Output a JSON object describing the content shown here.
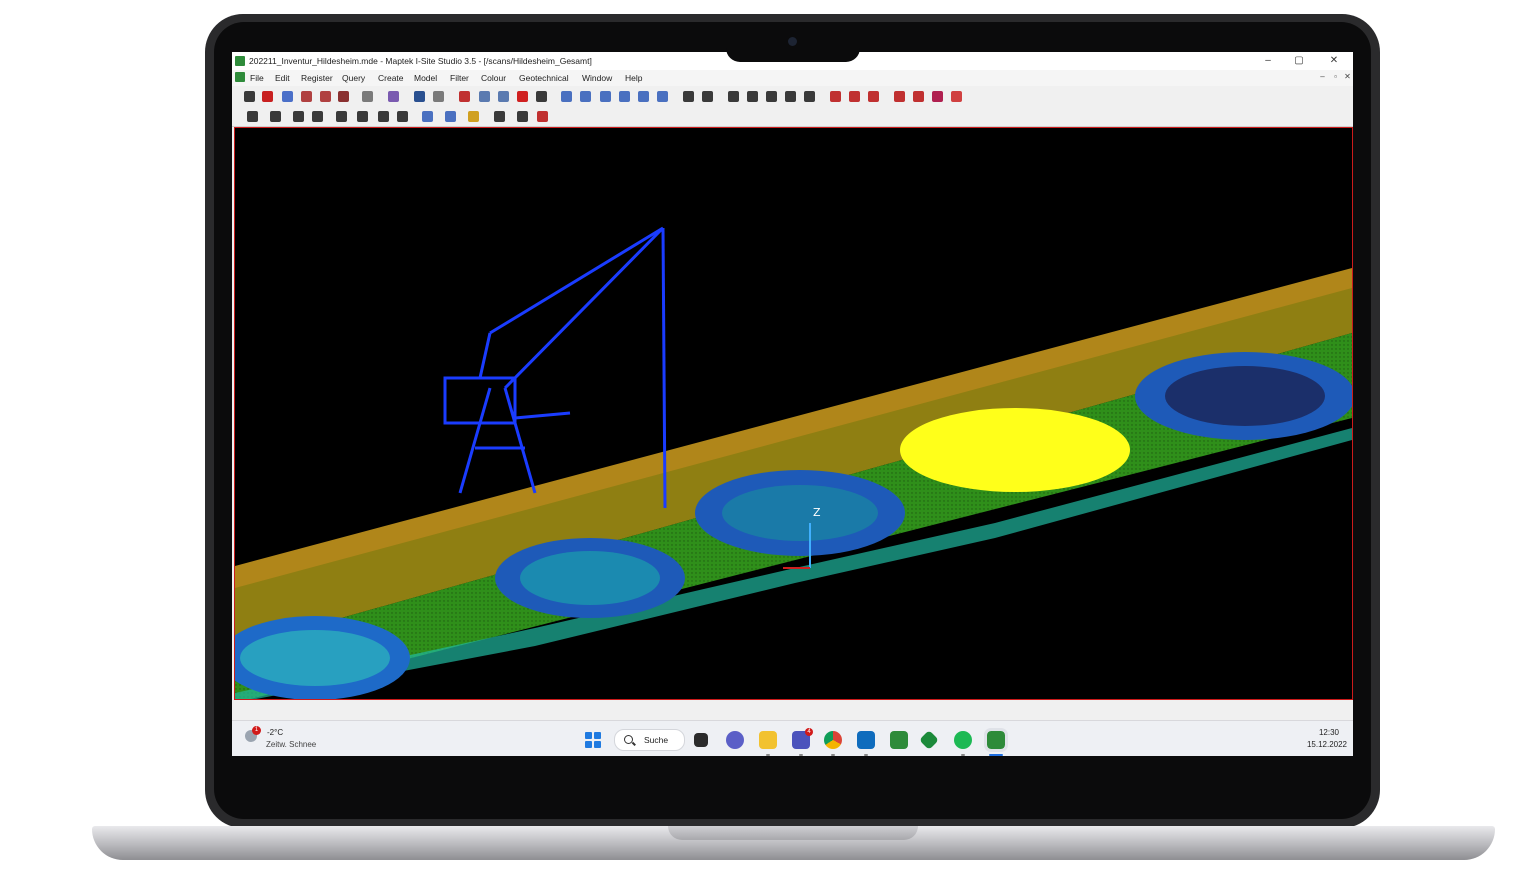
{
  "window": {
    "title": "202211_Inventur_Hildesheim.mde - Maptek I-Site Studio 3.5 - [/scans/Hildesheim_Gesamt]",
    "controls": {
      "minimize": "–",
      "maximize": "▢",
      "close": "✕"
    },
    "mdi_controls": {
      "minimize": "–",
      "restore": "▫",
      "close": "✕"
    }
  },
  "menu": {
    "items": [
      "File",
      "Edit",
      "Register",
      "Query",
      "Create",
      "Model",
      "Filter",
      "Colour",
      "Geotechnical",
      "Window",
      "Help"
    ]
  },
  "viewport": {
    "axis_label": "Z",
    "point_cloud_colors": {
      "background": "#000000",
      "border": "#cc1b1b",
      "high": "#1a3cff",
      "mid": "#1fb8c8",
      "ground": "#2f8f1a",
      "rail": "#b08a10",
      "selected": "#ffff1a"
    }
  },
  "taskbar": {
    "weather": {
      "badge": "1",
      "temperature": "-2°C",
      "description": "Zeitw. Schnee"
    },
    "search_label": "Suche",
    "teams_badge": "4",
    "clock": {
      "time": "12:30",
      "date": "15.12.2022"
    }
  }
}
